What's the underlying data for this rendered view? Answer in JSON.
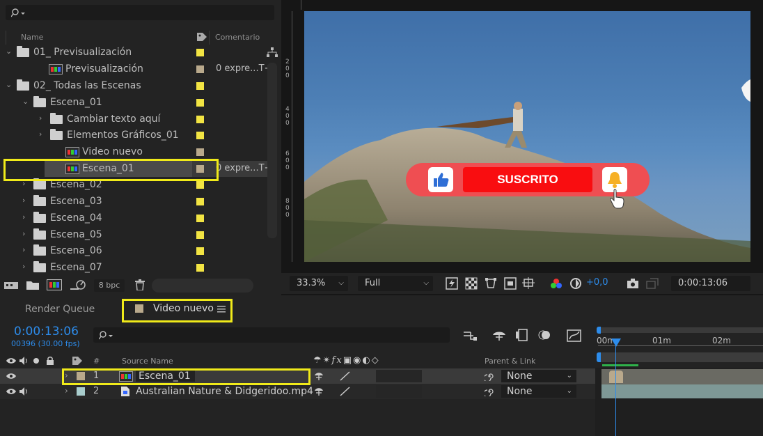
{
  "project": {
    "columns": {
      "name": "Name",
      "comment": "Comentario"
    },
    "items": [
      {
        "label": "01_ Previsualización",
        "kind": "folder",
        "expanded": true,
        "swatch": "#f2e443"
      },
      {
        "label": "Previsualización",
        "kind": "comp",
        "swatch": "#b9a98c",
        "comment": "0 expre...T+"
      },
      {
        "label": "02_ Todas las Escenas",
        "kind": "folder",
        "expanded": true,
        "swatch": "#f2e443"
      },
      {
        "label": "Escena_01",
        "kind": "folder",
        "expanded": true,
        "swatch": "#f2e443"
      },
      {
        "label": "Cambiar texto aquí",
        "kind": "folder",
        "expanded": false,
        "swatch": "#f2e443"
      },
      {
        "label": "Elementos Gráficos_01",
        "kind": "folder",
        "expanded": false,
        "swatch": "#f2e443"
      },
      {
        "label": "Video nuevo",
        "kind": "comp",
        "swatch": "#b9a98c",
        "comment": ""
      },
      {
        "label": "Escena_01",
        "kind": "comp",
        "swatch": "#b9a98c",
        "comment": "0 expre...T+",
        "selected": true
      },
      {
        "label": "Escena_02",
        "kind": "folder",
        "expanded": false,
        "swatch": "#f2e443"
      },
      {
        "label": "Escena_03",
        "kind": "folder",
        "expanded": false,
        "swatch": "#f2e443"
      },
      {
        "label": "Escena_04",
        "kind": "folder",
        "expanded": false,
        "swatch": "#f2e443"
      },
      {
        "label": "Escena_05",
        "kind": "folder",
        "expanded": false,
        "swatch": "#f2e443"
      },
      {
        "label": "Escena_06",
        "kind": "folder",
        "expanded": false,
        "swatch": "#f2e443"
      },
      {
        "label": "Escena_07",
        "kind": "folder",
        "expanded": false,
        "swatch": "#f2e443"
      }
    ],
    "bpc": "8 bpc"
  },
  "viewer": {
    "ruler_labels": [
      "2",
      "0",
      "0",
      "4",
      "0",
      "0",
      "6",
      "0",
      "0",
      "8",
      "0",
      "0"
    ],
    "overlay": {
      "button_text": "SUSCRITO"
    },
    "zoom": "33.3%",
    "resolution": "Full",
    "exposure": "+0,0",
    "timecode": "0:00:13:06"
  },
  "timeline": {
    "tabs": {
      "render_queue": "Render Queue",
      "active": "Video nuevo"
    },
    "current_time": "0:00:13:06",
    "frame_info": "00396 (30.00 fps)",
    "columns": {
      "hash": "#",
      "source_name": "Source Name",
      "parent_link": "Parent & Link"
    },
    "ruler": [
      "00m",
      "01m",
      "02m"
    ],
    "layers": [
      {
        "num": "1",
        "name": "Escena_01",
        "parent": "None",
        "label_color": "#b9a98c"
      },
      {
        "num": "2",
        "name": "Australian Nature & Didgeridoo.mp4",
        "parent": "None",
        "label_color": "#a8cccc"
      }
    ]
  },
  "colors": {
    "highlight": "#f0ea1a",
    "accent_blue": "#2d8ceb",
    "sky": "#4a7db4"
  }
}
